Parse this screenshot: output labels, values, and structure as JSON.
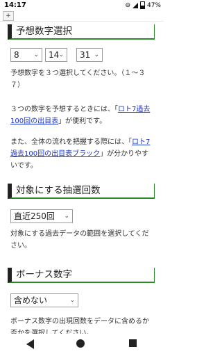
{
  "status": {
    "time": "14:17",
    "battery": "47%"
  },
  "toolbar": {
    "plus_label": "+"
  },
  "section1": {
    "title": "予想数字選択",
    "selects": [
      "8",
      "14",
      "31"
    ],
    "p1": "予想数字を３つ選択してください。（１～３７）",
    "p2_pre": "３つの数字を予想するときには、「",
    "p2_link": "ロト7過去100回の出目表",
    "p2_post": "」が便利です。",
    "p3_pre": "また、全体の流れを把握する際には、「",
    "p3_link": "ロト7過去100回の出目表ブラック",
    "p3_post": "」が分かりやすいです。"
  },
  "section2": {
    "title": "対象にする抽選回数",
    "select": "直近250回",
    "p1": "対象にする過去データの範囲を選択してください。"
  },
  "section3": {
    "title": "ボーナス数字",
    "select": "含めない",
    "p1": "ボーナス数字の出現回数をデータに含めるか否かを選択してください。"
  }
}
